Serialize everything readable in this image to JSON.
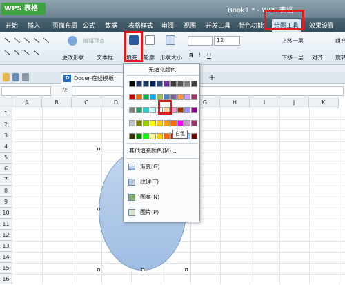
{
  "app": {
    "logo": "WPS 表格",
    "doc_title": "Book1 * - WPS 表格"
  },
  "menu": [
    "开始",
    "插入",
    "页面布局",
    "公式",
    "数据",
    "表格样式",
    "审阅",
    "视图",
    "开发工具",
    "特色功能",
    "绘图工具",
    "效果设置"
  ],
  "ribbon": {
    "edit_vertex": "编辑顶点",
    "change_shape": "更改形状",
    "textbox": "文本框",
    "fill": "填充",
    "outline": "轮廓",
    "shape_size": "形状大小",
    "font_size": "12",
    "bring_forward": "上移一层",
    "send_backward": "下移一层",
    "align": "对齐",
    "group": "组合",
    "rotate": "旋转"
  },
  "tab": {
    "label": "Docer-在线模板",
    "add": "+"
  },
  "formula": {
    "fx": "fx"
  },
  "columns": [
    "A",
    "B",
    "C",
    "D",
    "E",
    "F",
    "G",
    "H",
    "I",
    "J",
    "K"
  ],
  "rows": [
    "1",
    "2",
    "3",
    "4",
    "5",
    "6",
    "7",
    "8",
    "9",
    "10",
    "11",
    "12",
    "13",
    "14",
    "15",
    "16"
  ],
  "dropdown": {
    "no_fill": "无填充颜色",
    "more_colors": "其他填充颜色(M)...",
    "items": [
      "渐变(G)",
      "纹理(T)",
      "图案(N)",
      "图片(P)"
    ],
    "tooltip": "白色",
    "palette": [
      [
        "#000000",
        "#1f3864",
        "#17375e",
        "#002060",
        "#2e4d7b",
        "#7030a0",
        "#3a3a3a",
        "#595959",
        "#7f7f7f",
        "#404040"
      ],
      [
        "#c00000",
        "#e26b0a",
        "#00b050",
        "#00b0f0",
        "#9bbb59",
        "#4f81bd",
        "#8064a2",
        "#f79646",
        "#cc99ff",
        "#993366"
      ],
      [
        "#808080",
        "#339966",
        "#33cccc",
        "#ccffff",
        "#ffffff",
        "#ffcc99",
        "#ff99cc",
        "#993300",
        "#9999ff",
        "#800080"
      ],
      [
        "#c0c0c0",
        "#808000",
        "#99cc00",
        "#ffff00",
        "#ffcc00",
        "#ff9900",
        "#ff6600",
        "#ff00ff",
        "#cc99cc",
        "#993366"
      ],
      [
        "#333300",
        "#008000",
        "#00ff00",
        "#ffff99",
        "#ffcc00",
        "#ff6600",
        "#ff0000",
        "#cc0066",
        "#99ccff",
        "#660000"
      ]
    ]
  }
}
